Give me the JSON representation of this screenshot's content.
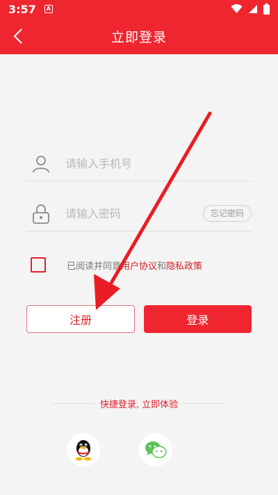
{
  "status_bar": {
    "time": "3:57",
    "notification_glyph": "A",
    "icons": [
      "wifi-icon",
      "signal-icon",
      "battery-icon"
    ]
  },
  "header": {
    "title": "立即登录",
    "back_icon": "chevron-left-icon"
  },
  "form": {
    "phone_placeholder": "请输入手机号",
    "phone_icon": "user-icon",
    "password_placeholder": "请输入密码",
    "password_icon": "lock-icon",
    "forgot_label": "忘记密码"
  },
  "agreement": {
    "prefix": "已阅读并同意",
    "user_agreement": "用户协议",
    "conjunction": "和",
    "privacy_policy": "隐私政策",
    "checked": false
  },
  "actions": {
    "register_label": "注册",
    "login_label": "登录"
  },
  "quick_login": {
    "label": "快捷登录, 立即体验",
    "providers": [
      "qq-icon",
      "wechat-icon"
    ]
  },
  "colors": {
    "brand": "#ef2630",
    "link": "#d41e26",
    "annotation_arrow": "#ea1c24"
  }
}
